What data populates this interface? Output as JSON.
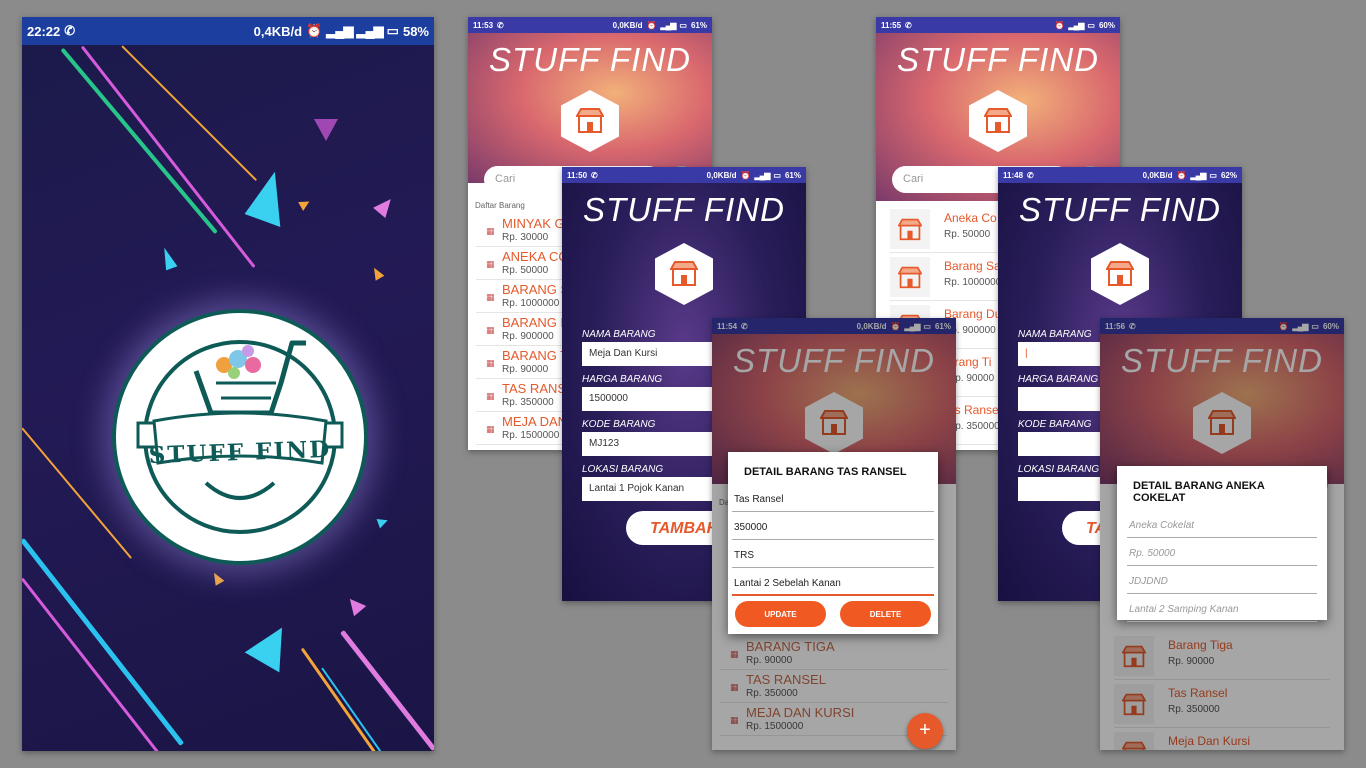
{
  "splash": {
    "status": {
      "time": "22:22",
      "speed": "0,4KB/d",
      "battery": "58%"
    },
    "logo_text": "STUFF FIND"
  },
  "app_title": "STUFF FIND",
  "search_placeholder": "Cari",
  "screen_list": {
    "status": {
      "time": "11:53",
      "speed": "0,0KB/d",
      "battery": "61%"
    },
    "section_label": "Daftar Barang",
    "items": [
      {
        "name": "MINYAK G",
        "price": "Rp. 30000"
      },
      {
        "name": "ANEKA CO",
        "price": "Rp. 50000"
      },
      {
        "name": "BARANG S",
        "price": "Rp. 1000000"
      },
      {
        "name": "BARANG D",
        "price": "Rp. 900000"
      },
      {
        "name": "BARANG T",
        "price": "Rp. 90000"
      },
      {
        "name": "TAS RANS",
        "price": "Rp. 350000"
      },
      {
        "name": "MEJA DAN",
        "price": "Rp. 1500000"
      }
    ]
  },
  "screen_form": {
    "status": {
      "time": "11:50",
      "speed": "0,0KB/d",
      "battery": "61%"
    },
    "fields": [
      {
        "label": "NAMA BARANG",
        "value": "Meja Dan Kursi"
      },
      {
        "label": "HARGA BARANG",
        "value": "1500000"
      },
      {
        "label": "KODE BARANG",
        "value": "MJ123"
      },
      {
        "label": "LOKASI BARANG",
        "value": "Lantai 1 Pojok Kanan"
      }
    ],
    "button": "TAMBAH"
  },
  "screen_dialog1": {
    "status": {
      "time": "11:54",
      "speed": "0,0KB/d",
      "battery": "61%"
    },
    "section_label": "Da",
    "dialog_title": "DETAIL BARANG TAS RANSEL",
    "fields": [
      "Tas Ransel",
      "350000",
      "TRS",
      "Lantai 2 Sebelah Kanan"
    ],
    "update_label": "UPDATE",
    "delete_label": "DELETE",
    "bg_items": [
      {
        "name": "BARANG TIGA",
        "price": "Rp. 90000"
      },
      {
        "name": "TAS RANSEL",
        "price": "Rp. 350000"
      },
      {
        "name": "MEJA DAN KURSI",
        "price": "Rp. 1500000"
      }
    ],
    "fab_label": "+"
  },
  "screen_list2": {
    "status": {
      "time": "11:55",
      "battery": "60%"
    },
    "items": [
      {
        "name": "Aneka Co",
        "price": "Rp. 50000"
      },
      {
        "name": "Barang Sa",
        "price": "Rp. 1000000"
      },
      {
        "name": "Barang Du",
        "price": "Rp. 900000"
      }
    ],
    "peek_items": [
      {
        "name": "erang Ti",
        "price": "Rp. 90000"
      },
      {
        "name": "as Ransel",
        "price": "Rp. 350000"
      },
      {
        "name": "eja Dan"
      }
    ]
  },
  "screen_form2": {
    "status": {
      "time": "11:48",
      "speed": "0,0KB/d",
      "battery": "62%"
    },
    "fields": [
      "NAMA BARANG",
      "HARGA BARANG",
      "KODE BARANG",
      "LOKASI BARANG"
    ],
    "cursor": "|",
    "button": "TA"
  },
  "screen_dialog2": {
    "status": {
      "time": "11:56",
      "battery": "60%"
    },
    "dialog_title": "DETAIL BARANG ANEKA COKELAT",
    "fields": [
      "Aneka Cokelat",
      "Rp. 50000",
      "JDJDND",
      "Lantai 2 Samping Kanan"
    ],
    "bg_items": [
      {
        "name": "Barang Tiga",
        "price": "Rp. 90000"
      },
      {
        "name": "Tas Ransel",
        "price": "Rp. 350000"
      },
      {
        "name": "Meja Dan Kursi"
      }
    ]
  },
  "colors": {
    "accent": "#e5592b",
    "statusbar": "#3a3aa6",
    "splash_statusbar": "#1c3e9e",
    "logo_ring": "#0e5a57"
  }
}
